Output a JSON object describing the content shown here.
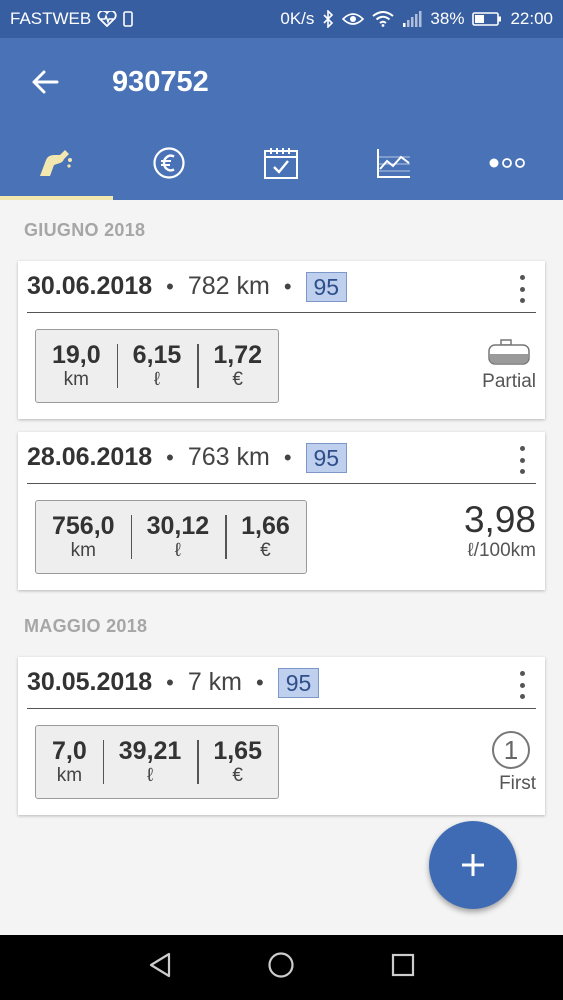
{
  "status_bar": {
    "carrier": "FASTWEB",
    "speed": "0K/s",
    "battery": "38%",
    "time": "22:00"
  },
  "app_bar": {
    "title": "930752"
  },
  "tabs": [
    {
      "icon": "fuel-pump-icon",
      "active": true
    },
    {
      "icon": "euro-icon",
      "active": false
    },
    {
      "icon": "calendar-icon",
      "active": false
    },
    {
      "icon": "chart-icon",
      "active": false
    },
    {
      "icon": "more-icon",
      "active": false
    }
  ],
  "sections": [
    {
      "title": "GIUGNO 2018",
      "entries": [
        {
          "date": "30.06.2018",
          "odometer": "782 km",
          "fuel": "95",
          "stats": [
            {
              "value": "19,0",
              "unit": "km"
            },
            {
              "value": "6,15",
              "unit": "ℓ"
            },
            {
              "value": "1,72",
              "unit": "€"
            }
          ],
          "side_label": "Partial"
        },
        {
          "date": "28.06.2018",
          "odometer": "763 km",
          "fuel": "95",
          "stats": [
            {
              "value": "756,0",
              "unit": "km"
            },
            {
              "value": "30,12",
              "unit": "ℓ"
            },
            {
              "value": "1,66",
              "unit": "€"
            }
          ],
          "consumption_value": "3,98",
          "consumption_unit": "ℓ/100km"
        }
      ]
    },
    {
      "title": "MAGGIO 2018",
      "entries": [
        {
          "date": "30.05.2018",
          "odometer": "7 km",
          "fuel": "95",
          "stats": [
            {
              "value": "7,0",
              "unit": "km"
            },
            {
              "value": "39,21",
              "unit": "ℓ"
            },
            {
              "value": "1,65",
              "unit": "€"
            }
          ],
          "first_number": "1",
          "side_label": "First"
        }
      ]
    }
  ],
  "fab": {
    "icon": "plus-icon"
  },
  "colors": {
    "primary": "#4a72b6",
    "status_bar": "#375ea0",
    "tab_indicator": "#f3e7b0",
    "badge_bg": "#bfd0ee",
    "fab": "#3e6bb4"
  }
}
